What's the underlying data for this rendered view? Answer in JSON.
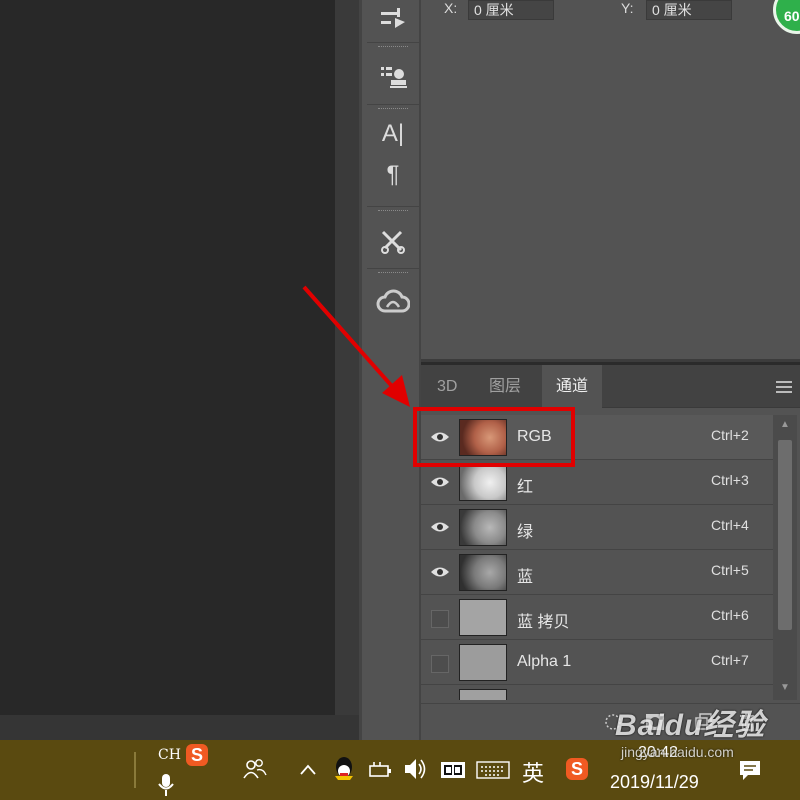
{
  "properties": {
    "x_label": "X:",
    "x_value": "0 厘米",
    "y_label": "Y:",
    "y_value": "0 厘米",
    "badge_text": "60"
  },
  "tools": {
    "text_tool_glyph": "A|",
    "paragraph_glyph": "¶"
  },
  "panel": {
    "tabs": [
      {
        "label": "3D",
        "active": false
      },
      {
        "label": "图层",
        "active": false
      },
      {
        "label": "通道",
        "active": true
      }
    ]
  },
  "channels": [
    {
      "name": "RGB",
      "shortcut": "Ctrl+2",
      "visible": true,
      "thumb": "color"
    },
    {
      "name": "红",
      "shortcut": "Ctrl+3",
      "visible": true,
      "thumb": "red"
    },
    {
      "name": "绿",
      "shortcut": "Ctrl+4",
      "visible": true,
      "thumb": "green"
    },
    {
      "name": "蓝",
      "shortcut": "Ctrl+5",
      "visible": true,
      "thumb": "blue"
    },
    {
      "name": "蓝 拷贝",
      "shortcut": "Ctrl+6",
      "visible": false,
      "thumb": "copy"
    },
    {
      "name": "Alpha 1",
      "shortcut": "Ctrl+7",
      "visible": false,
      "thumb": "alpha"
    }
  ],
  "taskbar": {
    "ime_label": "CH",
    "sogou_glyph": "S",
    "lang_label": "英",
    "time": "20:42",
    "date": "2019/11/29"
  },
  "watermark": {
    "brand": "Baidu经验",
    "url": "jingyan.baidu.com"
  },
  "colors": {
    "highlight": "#e10000",
    "badge": "#2fb04b",
    "taskbar": "#5a4a10"
  }
}
